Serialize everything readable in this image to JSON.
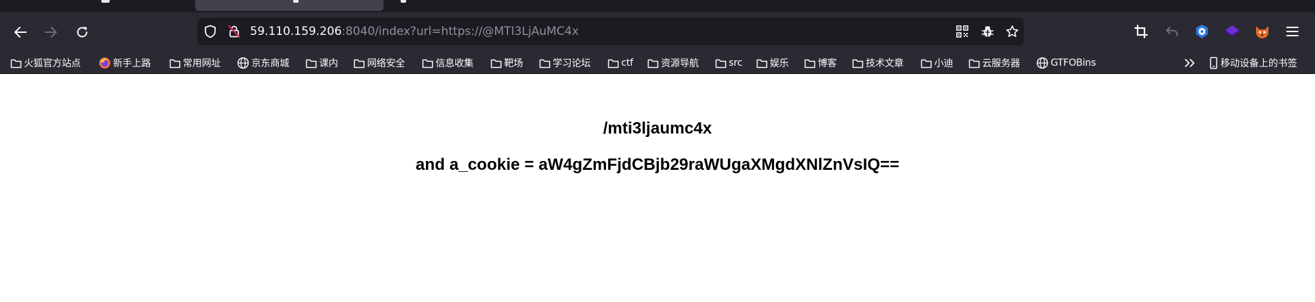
{
  "browser": {
    "url": {
      "host": "59.110.159.206",
      "rest": ":8040/index?url=https://@MTI3LjAuMC4x"
    },
    "bookmarks": [
      {
        "label": "火狐官方站点",
        "icon": "folder-icon"
      },
      {
        "label": "新手上路",
        "icon": "firefox-icon"
      },
      {
        "label": "常用网址",
        "icon": "folder-icon"
      },
      {
        "label": "京东商城",
        "icon": "globe-icon"
      },
      {
        "label": "课内",
        "icon": "folder-icon"
      },
      {
        "label": "网络安全",
        "icon": "folder-icon"
      },
      {
        "label": "信息收集",
        "icon": "folder-icon"
      },
      {
        "label": "靶场",
        "icon": "folder-icon"
      },
      {
        "label": "学习论坛",
        "icon": "folder-icon"
      },
      {
        "label": "ctf",
        "icon": "folder-icon"
      },
      {
        "label": "资源导航",
        "icon": "folder-icon"
      },
      {
        "label": "src",
        "icon": "folder-icon"
      },
      {
        "label": "娱乐",
        "icon": "folder-icon"
      },
      {
        "label": "博客",
        "icon": "folder-icon"
      },
      {
        "label": "技术文章",
        "icon": "folder-icon"
      },
      {
        "label": "小迪",
        "icon": "folder-icon"
      },
      {
        "label": "云服务器",
        "icon": "folder-icon"
      },
      {
        "label": "GTFOBins",
        "icon": "globe-icon"
      }
    ],
    "mobile_bookmarks": "移动设备上的书签"
  },
  "page": {
    "heading": "/mti3ljaumc4x",
    "cookie_line": "and a_cookie = aW4gZmFjdCBjb29raWUgaXMgdXNlZnVsIQ=="
  },
  "colors": {
    "toolbar": "#2b2a33",
    "tabstrip": "#1c1b22",
    "urlbar": "#1c1b22",
    "text_light": "#fbfbfe",
    "text_dim": "#8f8f9d",
    "insecure_red": "#e22850",
    "ext_blue": "#2f7ae5",
    "ext_purple": "#6b2fd6",
    "ext_orange": "#e86a24"
  }
}
